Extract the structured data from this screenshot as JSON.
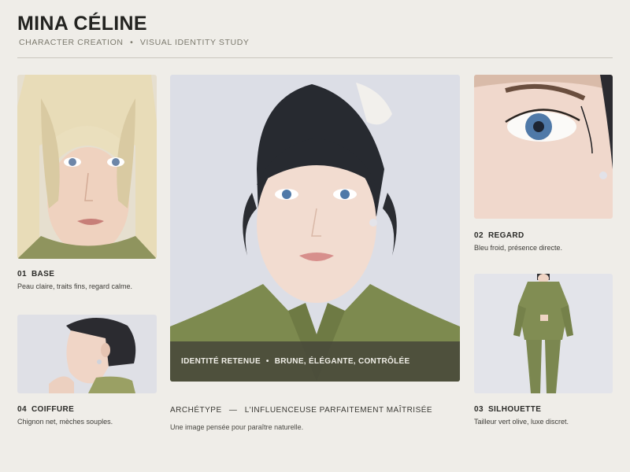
{
  "header": {
    "title": "MINA CÉLINE",
    "subtitle_left": "CHARACTER CREATION",
    "subtitle_sep": "•",
    "subtitle_right": "VISUAL IDENTITY STUDY"
  },
  "cards": [
    {
      "num": "01",
      "title": "BASE",
      "desc": "Peau claire, traits fins, regard calme."
    },
    {
      "num": "02",
      "title": "REGARD",
      "desc": "Bleu froid, présence directe."
    },
    {
      "num": "03",
      "title": "SILHOUETTE",
      "desc": "Tailleur vert olive, luxe discret."
    },
    {
      "num": "04",
      "title": "COIFFURE",
      "desc": "Chignon net, mèches souples."
    }
  ],
  "hero": {
    "overlay_left": "IDENTITÉ RETENUE",
    "overlay_sep": "•",
    "overlay_right": "BRUNE, ÉLÉGANTE, CONTRÔLÉE"
  },
  "archetype": {
    "label": "ARCHÉTYPE",
    "dash": "—",
    "value": "L'INFLUENCEUSE PARFAITEMENT MAÎTRISÉE",
    "desc": "Une image pensée pour paraître naturelle."
  },
  "colors": {
    "background": "#efede8",
    "olive": "#7d8a4f",
    "overlay": "#48483a",
    "eye_blue": "#4f79a8"
  }
}
